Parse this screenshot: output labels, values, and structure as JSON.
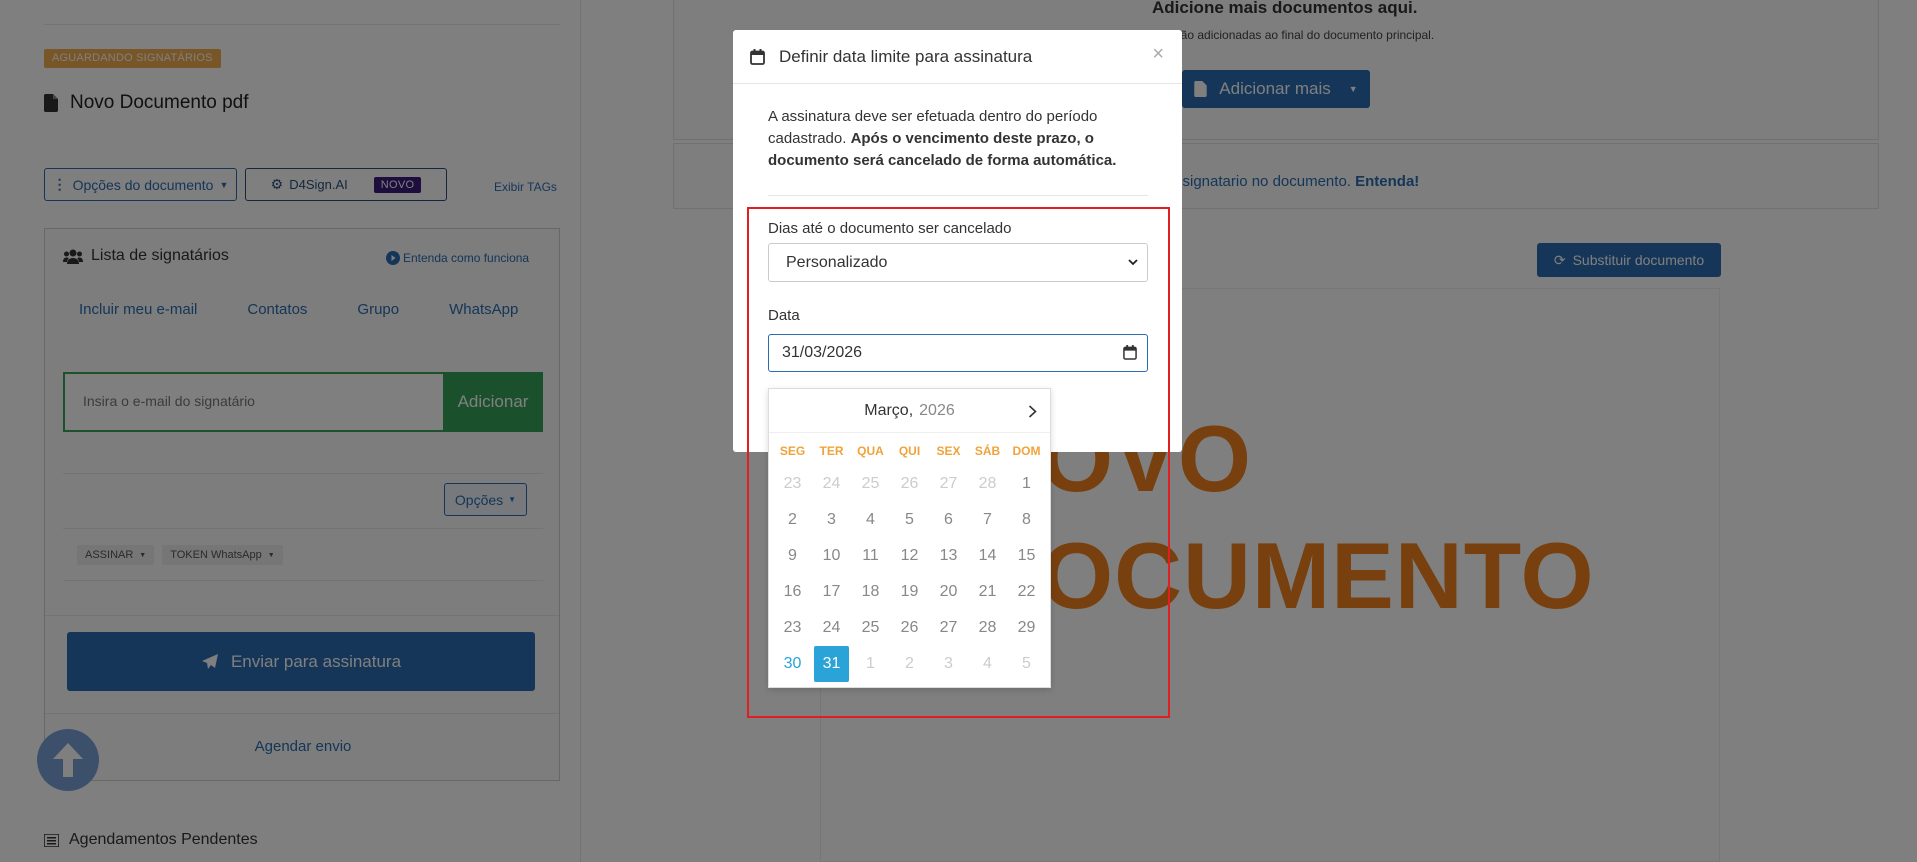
{
  "left": {
    "status_badge": "AGUARDANDO SIGNATÁRIOS",
    "doc_title": "Novo Documento pdf",
    "doc_options_button": "Opções do documento",
    "ai_button": "D4Sign.AI",
    "ai_badge": "NOVO",
    "show_tags_link": "Exibir TAGs",
    "signers": {
      "title": "Lista de signatários",
      "how_it_works": "Entenda como funciona",
      "tabs": [
        "Incluir meu e-mail",
        "Contatos",
        "Grupo",
        "WhatsApp"
      ],
      "email_placeholder": "Insira o e-mail do signatário",
      "add_button": "Adicionar",
      "options_button": "Opções",
      "tag_sign": "ASSINAR",
      "tag_token": "TOKEN WhatsApp",
      "send_button": "Enviar para assinatura",
      "schedule_link": "Agendar envio"
    },
    "pending_title": "Agendamentos Pendentes"
  },
  "right": {
    "add_docs_title": "Adicione mais documentos aqui.",
    "add_docs_sub": "erão adicionadas ao final do documento principal.",
    "add_more_button": "Adicionar mais",
    "signer_hint": "o signatario no documento.",
    "signer_hint_link": "Entenda!",
    "replace_button": "Substituir documento",
    "preview_line1": "OVO",
    "preview_line2": "OCUMENTO"
  },
  "modal": {
    "title": "Definir data limite para assinatura",
    "close": "×",
    "text_plain": "A assinatura deve ser efetuada dentro do período cadastrado.",
    "text_bold": "Após o vencimento deste prazo, o documento será cancelado de forma automática.",
    "days_label": "Dias até o documento ser cancelado",
    "days_value": "Personalizado",
    "date_label": "Data",
    "date_value": "31/03/2026"
  },
  "calendar": {
    "month": "Março,",
    "year": "2026",
    "weekdays": [
      "SEG",
      "TER",
      "QUA",
      "QUI",
      "SEX",
      "SÁB",
      "DOM"
    ],
    "weeks": [
      [
        "23",
        "24",
        "25",
        "26",
        "27",
        "28",
        "1"
      ],
      [
        "2",
        "3",
        "4",
        "5",
        "6",
        "7",
        "8"
      ],
      [
        "9",
        "10",
        "11",
        "12",
        "13",
        "14",
        "15"
      ],
      [
        "16",
        "17",
        "18",
        "19",
        "20",
        "21",
        "22"
      ],
      [
        "23",
        "24",
        "25",
        "26",
        "27",
        "28",
        "29"
      ],
      [
        "30",
        "31",
        "1",
        "2",
        "3",
        "4",
        "5"
      ]
    ],
    "selected": "31"
  },
  "colors": {
    "primary": "#2a6db1",
    "success": "#34a358",
    "warning": "#f0ad4e",
    "highlight": "#e02020",
    "selected_day": "#2aa3d8"
  }
}
